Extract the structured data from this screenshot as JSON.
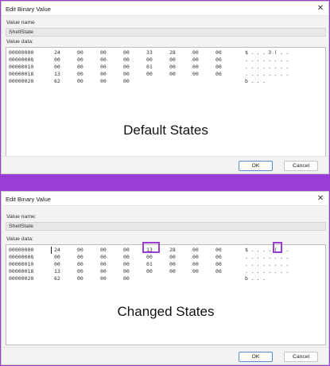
{
  "accent_color": "#9a3dd6",
  "dialog_top": {
    "title": "Edit Binary Value",
    "close_glyph": "✕",
    "value_name_label": "Value name",
    "value_name": "ShellState",
    "value_data_label": "Value data:",
    "rows": [
      {
        "addr": "00000000",
        "bytes": [
          "24",
          "00",
          "00",
          "00",
          "33",
          "28",
          "00",
          "00"
        ],
        "ascii": "$...3(.."
      },
      {
        "addr": "00000008",
        "bytes": [
          "00",
          "00",
          "00",
          "00",
          "00",
          "00",
          "00",
          "00"
        ],
        "ascii": "........"
      },
      {
        "addr": "00000010",
        "bytes": [
          "00",
          "00",
          "00",
          "00",
          "01",
          "00",
          "00",
          "00"
        ],
        "ascii": "........"
      },
      {
        "addr": "00000018",
        "bytes": [
          "13",
          "00",
          "00",
          "00",
          "00",
          "00",
          "00",
          "00"
        ],
        "ascii": "........"
      },
      {
        "addr": "00000020",
        "bytes": [
          "62",
          "00",
          "00",
          "00",
          "",
          "",
          "",
          ""
        ],
        "ascii": "b..."
      }
    ],
    "caption": "Default States",
    "ok_label": "OK",
    "cancel_label": "Cancel"
  },
  "dialog_bottom": {
    "title": "Edit Binary Value",
    "close_glyph": "✕",
    "value_name_label": "Value name:",
    "value_name": "ShellState",
    "value_data_label": "Value data:",
    "rows": [
      {
        "addr": "00000000",
        "bytes": [
          "24",
          "00",
          "00",
          "00",
          "13",
          "28",
          "00",
          "00"
        ],
        "ascii": "$....(.."
      },
      {
        "addr": "00000008",
        "bytes": [
          "00",
          "00",
          "00",
          "00",
          "00",
          "00",
          "00",
          "00"
        ],
        "ascii": "........"
      },
      {
        "addr": "00000010",
        "bytes": [
          "00",
          "00",
          "00",
          "00",
          "01",
          "00",
          "00",
          "00"
        ],
        "ascii": "........"
      },
      {
        "addr": "00000018",
        "bytes": [
          "13",
          "00",
          "00",
          "00",
          "00",
          "00",
          "00",
          "00"
        ],
        "ascii": "........"
      },
      {
        "addr": "00000020",
        "bytes": [
          "62",
          "00",
          "00",
          "00",
          "",
          "",
          "",
          ""
        ],
        "ascii": "b..."
      }
    ],
    "caption": "Changed States",
    "ok_label": "OK",
    "cancel_label": "Cancel"
  }
}
